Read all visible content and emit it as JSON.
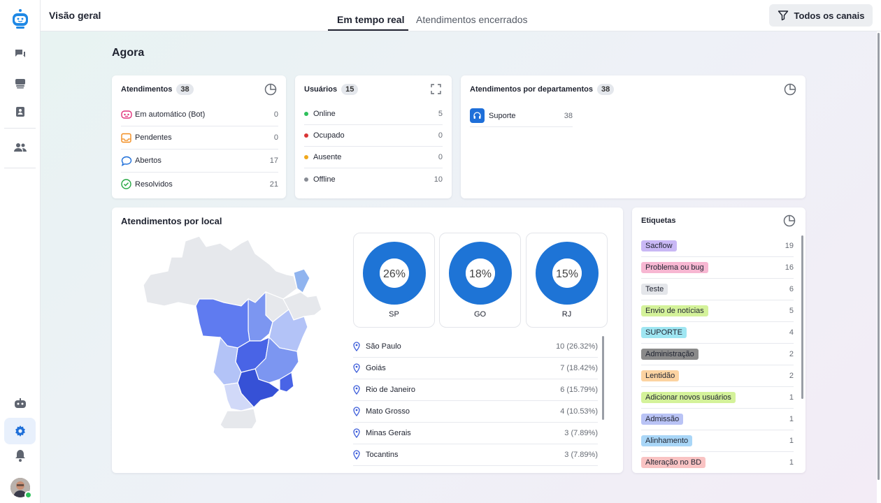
{
  "header": {
    "title": "Visão geral",
    "tabs": [
      {
        "label": "Em tempo real",
        "active": true
      },
      {
        "label": "Atendimentos encerrados",
        "active": false
      }
    ],
    "filter_label": "Todos os canais"
  },
  "sidebar": {
    "items": [
      {
        "name": "logo",
        "icon": "robot-logo-icon"
      },
      {
        "name": "chats",
        "icon": "chat-icon"
      },
      {
        "name": "inbox",
        "icon": "inbox-icon"
      },
      {
        "name": "contacts",
        "icon": "contact-card-icon"
      },
      {
        "name": "team",
        "icon": "users-icon"
      },
      {
        "name": "bot",
        "icon": "bot-icon"
      },
      {
        "name": "settings",
        "icon": "gear-icon",
        "active": true
      },
      {
        "name": "notifications",
        "icon": "bell-icon"
      }
    ],
    "accent": "#1e88e5"
  },
  "main": {
    "section_title": "Agora",
    "atendimentos": {
      "title": "Atendimentos",
      "count": "38",
      "rows": [
        {
          "label": "Em automático (Bot)",
          "value": "0",
          "icon": "bot-icon",
          "color": "#e0317a"
        },
        {
          "label": "Pendentes",
          "value": "0",
          "icon": "inbox-icon",
          "color": "#f28c1e"
        },
        {
          "label": "Abertos",
          "value": "17",
          "icon": "chat-bubble-icon",
          "color": "#1e6fd9"
        },
        {
          "label": "Resolvidos",
          "value": "21",
          "icon": "check-circle-icon",
          "color": "#26a743"
        }
      ]
    },
    "usuarios": {
      "title": "Usuários",
      "count": "15",
      "rows": [
        {
          "label": "Online",
          "value": "5",
          "color": "#2ec05b"
        },
        {
          "label": "Ocupado",
          "value": "0",
          "color": "#d93535"
        },
        {
          "label": "Ausente",
          "value": "0",
          "color": "#f0a81c"
        },
        {
          "label": "Offline",
          "value": "10",
          "color": "#888c94"
        }
      ]
    },
    "departamentos": {
      "title": "Atendimentos por departamentos",
      "count": "38",
      "rows": [
        {
          "label": "Suporte",
          "value": "38",
          "icon": "headset-icon"
        }
      ]
    },
    "local": {
      "title": "Atendimentos por local",
      "donuts": [
        {
          "label": "SP",
          "percent_text": "26%",
          "percent": 26
        },
        {
          "label": "GO",
          "percent_text": "18%",
          "percent": 18
        },
        {
          "label": "RJ",
          "percent_text": "15%",
          "percent": 15
        }
      ],
      "rows": [
        {
          "label": "São Paulo",
          "value": "10 (26.32%)"
        },
        {
          "label": "Goiás",
          "value": "7 (18.42%)"
        },
        {
          "label": "Rio de Janeiro",
          "value": "6 (15.79%)"
        },
        {
          "label": "Mato Grosso",
          "value": "4 (10.53%)"
        },
        {
          "label": "Minas Gerais",
          "value": "3 (7.89%)"
        },
        {
          "label": "Tocantins",
          "value": "3 (7.89%)"
        }
      ]
    },
    "etiquetas": {
      "title": "Etiquetas",
      "rows": [
        {
          "label": "Sacflow",
          "value": "19",
          "color": "#c9b8f5"
        },
        {
          "label": "Problema ou bug",
          "value": "16",
          "color": "#f7b7d2"
        },
        {
          "label": "Teste",
          "value": "6",
          "color": "#e4e6ea"
        },
        {
          "label": "Envio de notícias",
          "value": "5",
          "color": "#d4f29a"
        },
        {
          "label": "SUPORTE",
          "value": "4",
          "color": "#9fe6f2"
        },
        {
          "label": "Administração",
          "value": "2",
          "color": "#8a8a8a"
        },
        {
          "label": "Lentidão",
          "value": "2",
          "color": "#fcd3a1"
        },
        {
          "label": "Adicionar novos usuários",
          "value": "1",
          "color": "#d4f29a"
        },
        {
          "label": "Admissão",
          "value": "1",
          "color": "#b9c3f5"
        },
        {
          "label": "Alinhamento",
          "value": "1",
          "color": "#a9d6f7"
        },
        {
          "label": "Alteração no BD",
          "value": "1",
          "color": "#f9c3c3"
        }
      ]
    }
  }
}
